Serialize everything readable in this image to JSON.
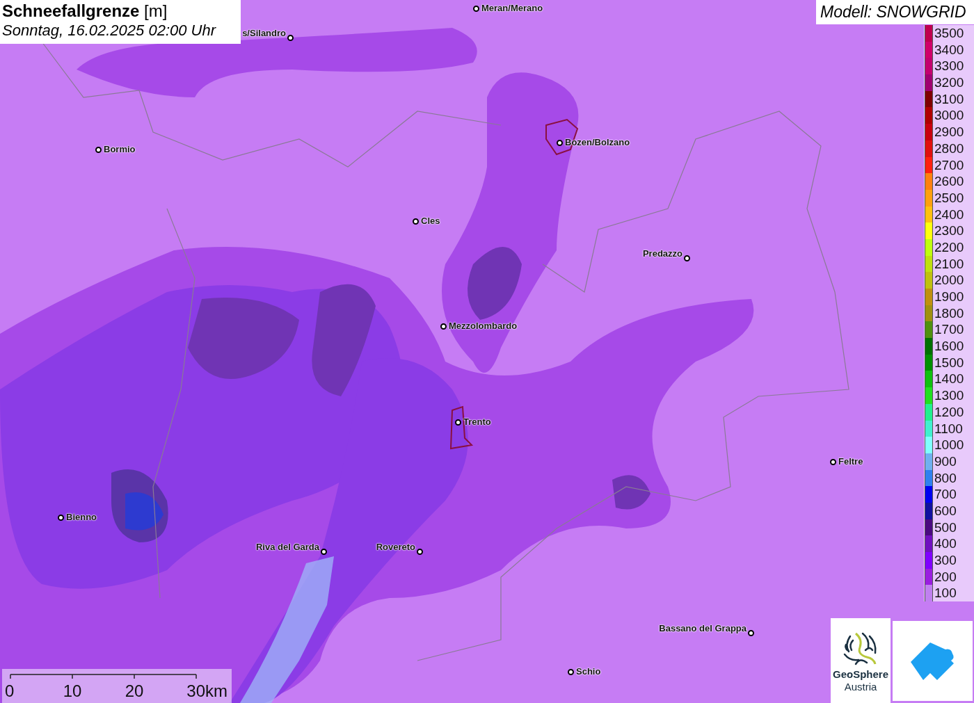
{
  "title": {
    "heading": "**Schneefallgrenze** [m]",
    "subtitle": "Sonntag, 16.02.2025 02:00 Uhr"
  },
  "model": "Modell: SNOWGRID",
  "cities": [
    {
      "name": "Meran/Merano"
    },
    {
      "name": "s/Silandro"
    },
    {
      "name": "Bormio"
    },
    {
      "name": "Bozen/Bolzano"
    },
    {
      "name": "Cles"
    },
    {
      "name": "Predazzo"
    },
    {
      "name": "Mezzolombardo"
    },
    {
      "name": "Trento"
    },
    {
      "name": "Feltre"
    },
    {
      "name": "Bienno"
    },
    {
      "name": "Riva del Garda"
    },
    {
      "name": "Rovereto"
    },
    {
      "name": "Bassano del Grappa"
    },
    {
      "name": "Schio"
    }
  ],
  "legend": [
    {
      "label": "3500",
      "color": "#c0004f"
    },
    {
      "label": "3400",
      "color": "#d0006a"
    },
    {
      "label": "3300",
      "color": "#c4006e"
    },
    {
      "label": "3200",
      "color": "#a00070"
    },
    {
      "label": "3100",
      "color": "#800000"
    },
    {
      "label": "3000",
      "color": "#b00000"
    },
    {
      "label": "2900",
      "color": "#c80010"
    },
    {
      "label": "2800",
      "color": "#e01010"
    },
    {
      "label": "2700",
      "color": "#ff2010"
    },
    {
      "label": "2600",
      "color": "#ff8010"
    },
    {
      "label": "2500",
      "color": "#ffa010"
    },
    {
      "label": "2400",
      "color": "#ffc010"
    },
    {
      "label": "2300",
      "color": "#ffff10"
    },
    {
      "label": "2200",
      "color": "#c0ff10"
    },
    {
      "label": "2100",
      "color": "#c0e010"
    },
    {
      "label": "2000",
      "color": "#c0c010"
    },
    {
      "label": "1900",
      "color": "#c09010"
    },
    {
      "label": "1800",
      "color": "#a09010"
    },
    {
      "label": "1700",
      "color": "#509010"
    },
    {
      "label": "1600",
      "color": "#007000"
    },
    {
      "label": "1500",
      "color": "#009000"
    },
    {
      "label": "1400",
      "color": "#10c010"
    },
    {
      "label": "1300",
      "color": "#20e020"
    },
    {
      "label": "1200",
      "color": "#20f090"
    },
    {
      "label": "1100",
      "color": "#40f0d0"
    },
    {
      "label": "1000",
      "color": "#80ffff"
    },
    {
      "label": "900",
      "color": "#70b0f0"
    },
    {
      "label": "800",
      "color": "#3080f0"
    },
    {
      "label": "700",
      "color": "#0000f0"
    },
    {
      "label": "600",
      "color": "#1010a0"
    },
    {
      "label": "500",
      "color": "#4a0a80"
    },
    {
      "label": "400",
      "color": "#7010c0"
    },
    {
      "label": "300",
      "color": "#8000ff"
    },
    {
      "label": "200",
      "color": "#9a1ee0"
    },
    {
      "label": "100",
      "color": "#c080f0"
    }
  ],
  "scale_bar": [
    "0",
    "10",
    "20",
    "30km"
  ],
  "logo": {
    "line_1": "GeoSphere",
    "line_2": "Austria"
  }
}
